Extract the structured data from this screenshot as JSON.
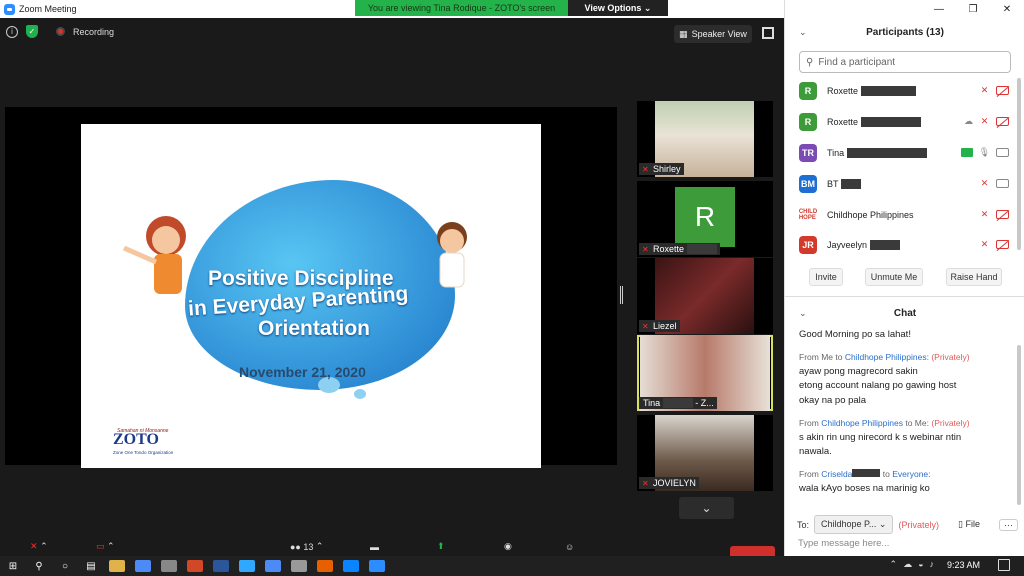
{
  "window": {
    "title": "Zoom Meeting"
  },
  "banner": {
    "viewing": "You are viewing Tina Rodique - ZOTO's screen",
    "view_options": "View Options"
  },
  "meeting": {
    "recording": "Recording",
    "speaker_view": "Speaker View",
    "slide": {
      "line1": "Positive Discipline",
      "line2": "in Everyday Parenting",
      "line3": "Orientation",
      "date": "November 21, 2020",
      "logo_org_top": "Samahan ni Monsanne",
      "logo_text": "ZOTO",
      "logo_sub": "Zone One Tondo Organization"
    },
    "videos": [
      {
        "name": "Shirley"
      },
      {
        "name": "Roxette",
        "initial": "R"
      },
      {
        "name": "Liezel"
      },
      {
        "name": "Tina",
        "suffix": "- Z..."
      },
      {
        "name": "JOVIELYN"
      }
    ],
    "participant_count": "13"
  },
  "participants": {
    "header": "Participants (13)",
    "search_placeholder": "Find a participant",
    "list": [
      {
        "initials": "R",
        "name": "Roxette",
        "color": "#3e9b3a"
      },
      {
        "initials": "R",
        "name": "Roxette",
        "color": "#3e9b3a"
      },
      {
        "initials": "TR",
        "name": "Tina",
        "color": "#7b4bb3"
      },
      {
        "initials": "BM",
        "name": "BT",
        "color": "#1e6fd1"
      },
      {
        "initials": "CH",
        "name": "Childhope Philippines",
        "color": "#ffffff"
      },
      {
        "initials": "JR",
        "name": "Jayveelyn",
        "color": "#d33a2c"
      }
    ],
    "buttons": {
      "invite": "Invite",
      "unmute": "Unmute Me",
      "raise": "Raise Hand"
    }
  },
  "chat": {
    "header": "Chat",
    "messages": [
      {
        "text": "Good Morning po sa lahat!"
      },
      {
        "from": "From Me to",
        "to": "Childhope Philippines:",
        "privately": "(Privately)",
        "lines": [
          "ayaw pong magrecord sakin",
          "etong account nalang po gawing host",
          "okay na po pala"
        ]
      },
      {
        "from": "From",
        "sender": "Childhope Philippines",
        "to_me": "to Me:",
        "privately": "(Privately)",
        "lines": [
          "s akin rin ung nirecord k s webinar ntin",
          "nawala."
        ]
      },
      {
        "from": "From",
        "sender": "Criselda",
        "to": "to",
        "target": "Everyone:",
        "lines": [
          "wala kAyo boses na marinig ko"
        ]
      }
    ],
    "to_label": "To:",
    "to_value": "Childhope P...",
    "to_privately": "(Privately)",
    "file": "File",
    "input_placeholder": "Type message here..."
  },
  "taskbar": {
    "time": "9:23 AM"
  },
  "colors": {
    "accent": "#2d8cff",
    "banner_green": "#24b34a",
    "active_speaker": "#d5e25d"
  }
}
